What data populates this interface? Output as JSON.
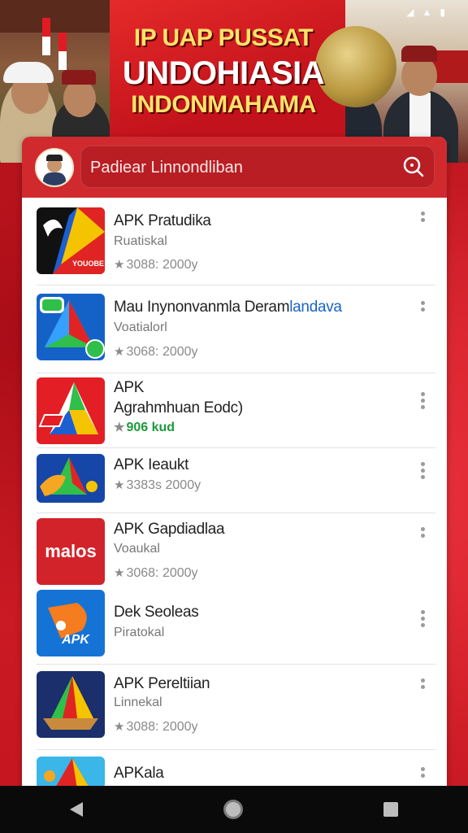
{
  "banner": {
    "line1": "IP UAP PUSSAT",
    "line2": "UNDOHIASIA",
    "line3": "INDONMAHAMA"
  },
  "search": {
    "placeholder": "Padiear Linnondliban"
  },
  "apps": [
    {
      "title": "APK Pratudika",
      "subtitle": "Ruatiskal",
      "meta": "3088: 2000y"
    },
    {
      "title_main": "Mau Inynonvanmla Deram",
      "title_highlight": "landava",
      "subtitle": "Voatialorl",
      "meta": "3068: 2000y"
    },
    {
      "title": "APK",
      "subtitle": "Agrahmhuan Eodc)",
      "meta": "906 kud"
    },
    {
      "title": "APK Ieaukt",
      "subtitle": "",
      "meta": "3383s 2000y"
    },
    {
      "title": "APK Gapdiadlaa",
      "subtitle": "Voaukal",
      "meta": "3068: 2000y"
    },
    {
      "title": "Dek Seoleas",
      "subtitle": "Piratokal",
      "meta": ""
    },
    {
      "title": "APK Pereltiian",
      "subtitle": "Linnekal",
      "meta": "3088: 2000y"
    },
    {
      "title": "APKala",
      "subtitle": "",
      "meta": ""
    }
  ],
  "icon_labels": {
    "app1": "YOUOBE",
    "app4": "",
    "app5": "malos",
    "app6": "APK"
  },
  "colors": {
    "primary_red": "#c8141e",
    "header_red": "#d02a2e",
    "highlight_blue": "#1a63c9",
    "meta_green": "#1b9a3a"
  },
  "icons": {
    "search": "search-icon",
    "more": "more-vert-icon",
    "nav_back": "back-triangle-icon",
    "nav_home": "home-circle-icon",
    "nav_recent": "recent-square-icon"
  }
}
